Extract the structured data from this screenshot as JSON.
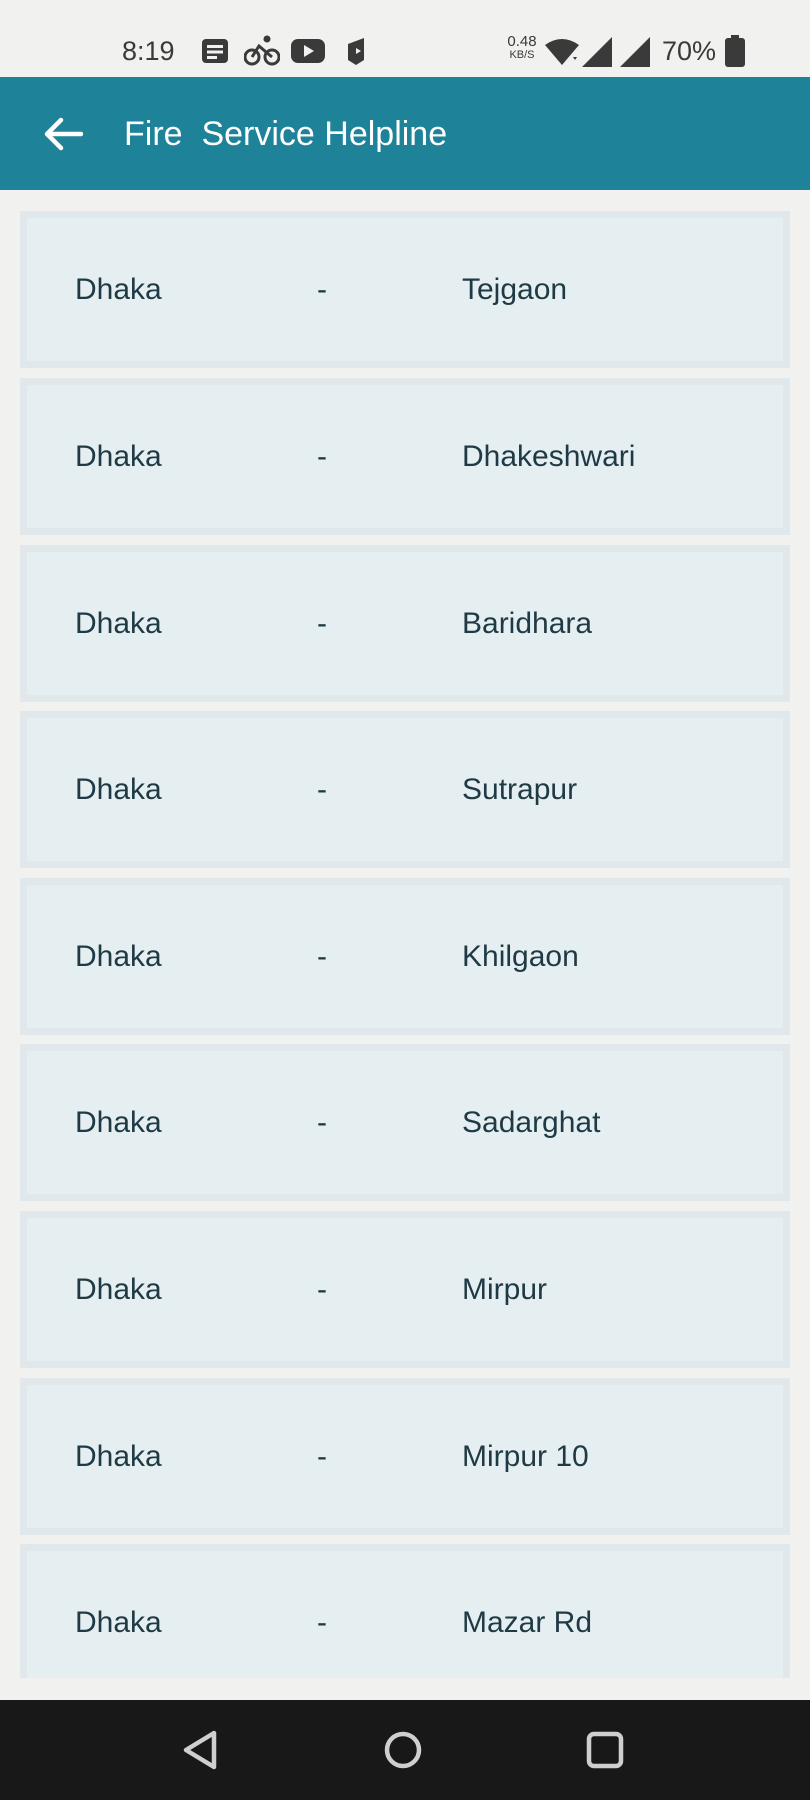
{
  "status_bar": {
    "time": "8:19",
    "net_speed_value": "0.48",
    "net_speed_unit": "KB/S",
    "battery": "70%",
    "icons": [
      "notes-icon",
      "cycling-icon",
      "youtube-icon",
      "app-icon",
      "wifi-icon",
      "signal-icon",
      "signal-icon",
      "battery-icon"
    ]
  },
  "app_bar": {
    "title": "Fire  Service Helpline",
    "back_icon": "arrow-left-icon",
    "color": "#1e8299"
  },
  "list": {
    "items": [
      {
        "city": "Dhaka",
        "separator": "-",
        "station": "Tejgaon"
      },
      {
        "city": "Dhaka",
        "separator": "-",
        "station": "Dhakeshwari"
      },
      {
        "city": "Dhaka",
        "separator": "-",
        "station": "Baridhara"
      },
      {
        "city": "Dhaka",
        "separator": "-",
        "station": "Sutrapur"
      },
      {
        "city": "Dhaka",
        "separator": "-",
        "station": "Khilgaon"
      },
      {
        "city": "Dhaka",
        "separator": "-",
        "station": "Sadarghat"
      },
      {
        "city": "Dhaka",
        "separator": "-",
        "station": "Mirpur"
      },
      {
        "city": "Dhaka",
        "separator": "-",
        "station": "Mirpur 10"
      },
      {
        "city": "Dhaka",
        "separator": "-",
        "station": "Mazar Rd"
      }
    ]
  },
  "nav_bar": {
    "buttons": [
      "back-triangle-icon",
      "home-circle-icon",
      "recents-square-icon"
    ]
  }
}
